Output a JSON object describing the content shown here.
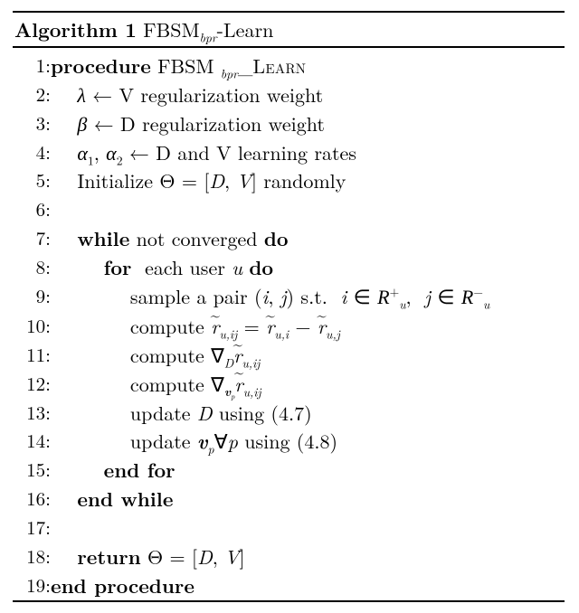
{
  "algo": {
    "label": "Algorithm 1",
    "name_a": "FBSM",
    "name_sub": "bpr",
    "name_b": "-Learn",
    "proc_kw": "procedure",
    "proc_name_a": "FBSM ",
    "proc_sub": "bpr",
    "proc_suffix": "Learn",
    "endproc": "end procedure",
    "while": "while",
    "while_cond": " not converged ",
    "do": "do",
    "endwhile": "end while",
    "for": "for",
    "for_cond": "  each user ",
    "for_var": "u",
    "endfor": "end for",
    "return": "return",
    "l2_a": "λ",
    "l2_b": " ← V regularization weight",
    "l3_a": "β",
    "l3_b": " ← D regularization weight",
    "l4_a": "α",
    "l4_sub1": "1",
    "l4_mid": ", ",
    "l4_a2": "α",
    "l4_sub2": "2",
    "l4_b": " ← D and V learning rates",
    "l5_a": "Initialize Θ = [",
    "l5_D": "D",
    "l5_mid": ", ",
    "l5_V": "V",
    "l5_b": "] randomly",
    "l9_a": "sample a pair (",
    "l9_i": "i",
    "l9_c1": ", ",
    "l9_j": "j",
    "l9_b": ") s.t.  ",
    "l9_i2": "i",
    "l9_in": " ∈ ",
    "l9_R": "R",
    "l9_sub_u": "u",
    "l9_sup_plus": "+",
    "l9_c2": ",  ",
    "l9_j2": "j",
    "l9_sup_minus": "−",
    "l10_a": "compute ",
    "l10_r": "r",
    "l10_sub1": "u,ij",
    "l10_eq": " = ",
    "l10_sub2": "u,i",
    "l10_minus": " − ",
    "l10_sub3": "u,j",
    "l11_a": "compute ∇",
    "l11_D": "D",
    "l11_r": "r",
    "l11_sub": "u,ij",
    "l12_a": "compute ∇",
    "l12_vp": "v",
    "l12_p": "p",
    "l12_r": "r",
    "l12_sub": "u,ij",
    "l13_a": "update ",
    "l13_D": "D",
    "l13_b": " using (4.7)",
    "l14_a": "update ",
    "l14_v": "v",
    "l14_p": "p",
    "l14_forall": "∀",
    "l14_p2": "p",
    "l14_b": " using (4.8)",
    "l18_a": "Θ = [",
    "l18_D": "D",
    "l18_mid": ", ",
    "l18_V": "V",
    "l18_b": "]",
    "nums": [
      "1:",
      "2:",
      "3:",
      "4:",
      "5:",
      "6:",
      "7:",
      "8:",
      "9:",
      "10:",
      "11:",
      "12:",
      "13:",
      "14:",
      "15:",
      "16:",
      "17:",
      "18:",
      "19:"
    ]
  }
}
